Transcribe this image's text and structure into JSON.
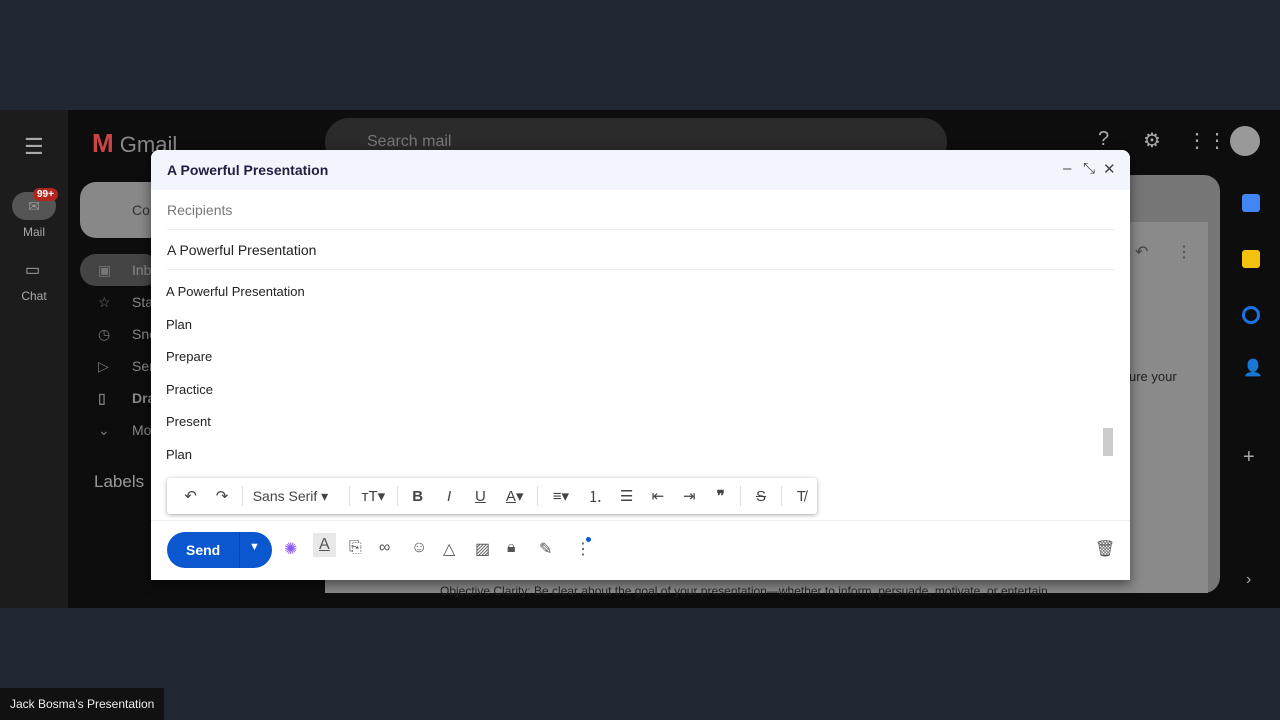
{
  "gmail": {
    "app_name": "Gmail",
    "search_placeholder": "Search mail",
    "badge": "99+",
    "rail": {
      "mail": "Mail",
      "chat": "Chat"
    },
    "compose_label": "Co",
    "nav": [
      "Inb",
      "Sta",
      "Sno",
      "Sen",
      "Dra",
      "Mo"
    ],
    "labels": "Labels",
    "reading_snippet": "ure your",
    "bottom_text": "Objective Clarity: Be clear about the goal of your presentation—whether to inform, persuade, motivate, or entertain"
  },
  "compose": {
    "title": "A Powerful Presentation",
    "recipients_placeholder": "Recipients",
    "subject": "A Powerful Presentation",
    "body_lines": [
      "A Powerful Presentation",
      "Plan",
      "Prepare",
      "Practice",
      "Present",
      "Plan"
    ],
    "font": "Sans Serif",
    "send_label": "Send"
  },
  "caption": "Jack Bosma's Presentation",
  "colors": {
    "send": "#0b57d0",
    "badge": "#b3261e"
  }
}
